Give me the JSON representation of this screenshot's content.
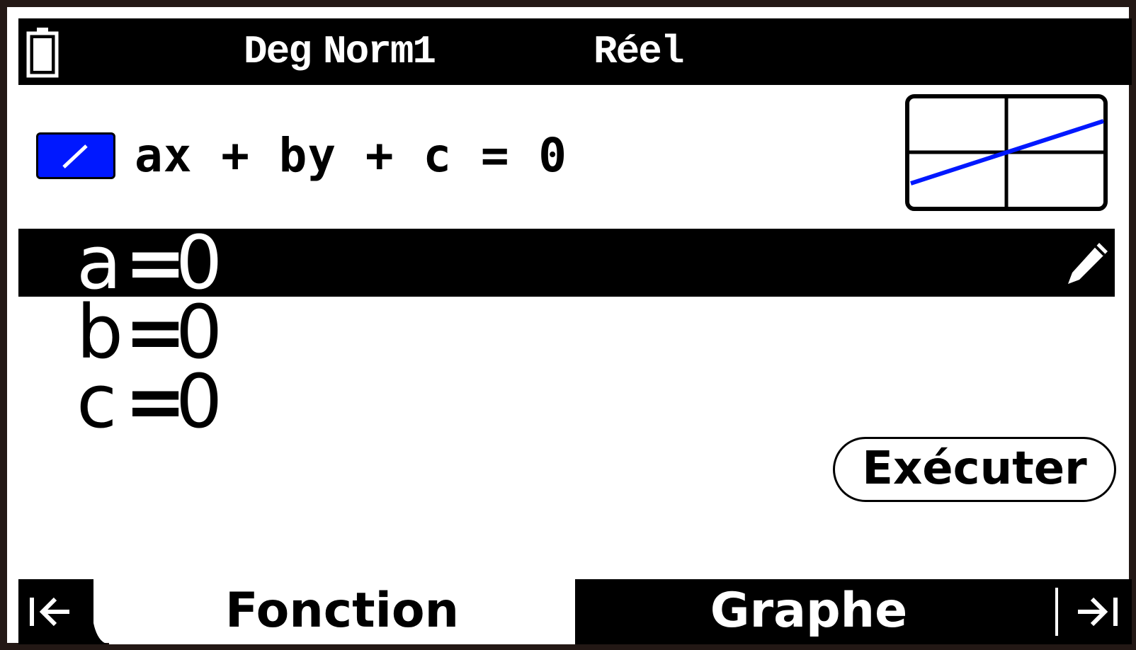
{
  "status": {
    "angle_unit": "Deg",
    "number_format": "Norm1",
    "complex_mode": "Réel"
  },
  "equation": {
    "form": "ax + by + c = 0",
    "icon": "line-icon",
    "icon_color": "#0018ff"
  },
  "coefficients": [
    {
      "name": "a",
      "eq": "=",
      "value": "0",
      "selected": true
    },
    {
      "name": "b",
      "eq": "=",
      "value": "0",
      "selected": false
    },
    {
      "name": "c",
      "eq": "=",
      "value": "0",
      "selected": false
    }
  ],
  "execute_label": "Exécuter",
  "tabs": {
    "active": "Fonction",
    "inactive": "Graphe"
  },
  "colors": {
    "accent": "#0018ff",
    "background": "#ffffff",
    "foreground": "#000000",
    "frame": "#231815"
  }
}
